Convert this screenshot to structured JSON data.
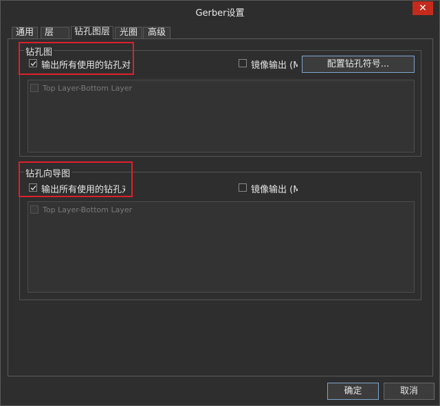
{
  "window": {
    "title": "Gerber设置",
    "close_glyph": "✕"
  },
  "tabs": [
    {
      "label": "通用"
    },
    {
      "label": "层"
    },
    {
      "label": "钻孔图层"
    },
    {
      "label": "光圈"
    },
    {
      "label": "高级"
    }
  ],
  "drill_drawing": {
    "title": "钻孔图",
    "plot_all_used": {
      "label": "输出所有使用的钻孔对",
      "checked": true
    },
    "mirror": {
      "label": "镜像输出 (M",
      "checked": false
    },
    "configure_button": "配置钻孔符号...",
    "layer_pairs": [
      {
        "label": "Top Layer-Bottom Layer",
        "checked": false
      }
    ]
  },
  "drill_guide": {
    "title": "钻孔向导图",
    "plot_all_used": {
      "label": "输出所有使用的钻孔对",
      "checked": true
    },
    "mirror": {
      "label": "镜像输出 (M",
      "checked": false
    },
    "layer_pairs": [
      {
        "label": "Top Layer-Bottom Layer",
        "checked": false
      }
    ]
  },
  "footer": {
    "ok_label": "确定",
    "cancel_label": "取消"
  },
  "colors": {
    "highlight": "#e0202a",
    "close_button": "#c42b1c"
  }
}
